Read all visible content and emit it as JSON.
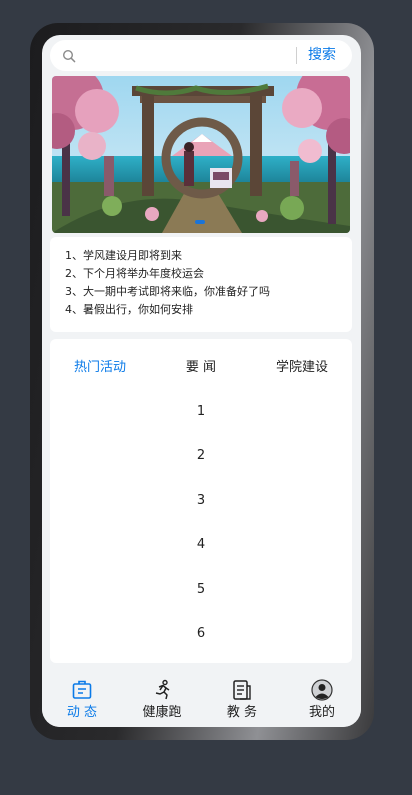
{
  "search": {
    "placeholder": "",
    "button_label": "搜索"
  },
  "banner": {
    "slides": 1,
    "active_index": 0
  },
  "notices": [
    "1、学风建设月即将到来",
    "2、下个月将举办年度校运会",
    "3、大一期中考试即将来临，你准备好了吗",
    "4、暑假出行，你如何安排"
  ],
  "tabs": [
    {
      "label": "热门活动",
      "active": true
    },
    {
      "label": "要 闻",
      "active": false
    },
    {
      "label": "学院建设",
      "active": false
    }
  ],
  "tab_content": [
    "1",
    "2",
    "3",
    "4",
    "5",
    "6"
  ],
  "bottom_nav": [
    {
      "label": "动 态",
      "icon": "dynamic-icon",
      "active": true
    },
    {
      "label": "健康跑",
      "icon": "running-icon",
      "active": false
    },
    {
      "label": "教 务",
      "icon": "document-icon",
      "active": false
    },
    {
      "label": "我的",
      "icon": "user-avatar-icon",
      "active": false
    }
  ],
  "colors": {
    "accent": "#0a7ae8",
    "background": "#343a44",
    "screen": "#f1f3f5"
  }
}
